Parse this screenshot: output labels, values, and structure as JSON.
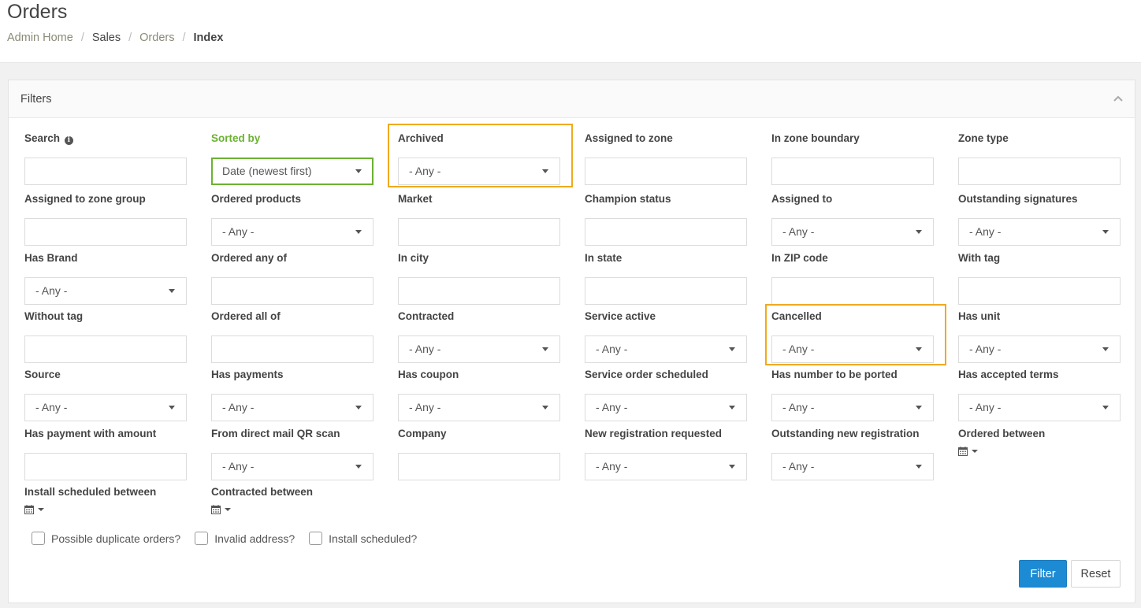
{
  "page": {
    "title": "Orders",
    "breadcrumb": [
      "Admin Home",
      "Sales",
      "Orders",
      "Index"
    ]
  },
  "filters": {
    "panel_title": "Filters",
    "fields": [
      {
        "name": "search",
        "label": "Search",
        "type": "text",
        "value": ""
      },
      {
        "name": "sorted-by",
        "label": "Sorted by",
        "type": "select",
        "value": "Date (newest first)"
      },
      {
        "name": "archived",
        "label": "Archived",
        "type": "select",
        "value": "- Any -"
      },
      {
        "name": "assigned-to-zone",
        "label": "Assigned to zone",
        "type": "text",
        "value": ""
      },
      {
        "name": "in-zone-boundary",
        "label": "In zone boundary",
        "type": "text",
        "value": ""
      },
      {
        "name": "zone-type",
        "label": "Zone type",
        "type": "text",
        "value": ""
      },
      {
        "name": "assigned-to-zone-group",
        "label": "Assigned to zone group",
        "type": "text",
        "value": ""
      },
      {
        "name": "ordered-products",
        "label": "Ordered products",
        "type": "select",
        "value": "- Any -"
      },
      {
        "name": "market",
        "label": "Market",
        "type": "text",
        "value": ""
      },
      {
        "name": "champion-status",
        "label": "Champion status",
        "type": "text",
        "value": ""
      },
      {
        "name": "assigned-to",
        "label": "Assigned to",
        "type": "select",
        "value": "- Any -"
      },
      {
        "name": "outstanding-signatures",
        "label": "Outstanding signatures",
        "type": "select",
        "value": "- Any -"
      },
      {
        "name": "has-brand",
        "label": "Has Brand",
        "type": "select",
        "value": "- Any -"
      },
      {
        "name": "ordered-any-of",
        "label": "Ordered any of",
        "type": "text",
        "value": ""
      },
      {
        "name": "in-city",
        "label": "In city",
        "type": "text",
        "value": ""
      },
      {
        "name": "in-state",
        "label": "In state",
        "type": "text",
        "value": ""
      },
      {
        "name": "in-zip-code",
        "label": "In ZIP code",
        "type": "text",
        "value": ""
      },
      {
        "name": "with-tag",
        "label": "With tag",
        "type": "text",
        "value": ""
      },
      {
        "name": "without-tag",
        "label": "Without tag",
        "type": "text",
        "value": ""
      },
      {
        "name": "ordered-all-of",
        "label": "Ordered all of",
        "type": "text",
        "value": ""
      },
      {
        "name": "contracted",
        "label": "Contracted",
        "type": "select",
        "value": "- Any -"
      },
      {
        "name": "service-active",
        "label": "Service active",
        "type": "select",
        "value": "- Any -"
      },
      {
        "name": "cancelled",
        "label": "Cancelled",
        "type": "select",
        "value": "- Any -"
      },
      {
        "name": "has-unit",
        "label": "Has unit",
        "type": "select",
        "value": "- Any -"
      },
      {
        "name": "source",
        "label": "Source",
        "type": "select",
        "value": "- Any -"
      },
      {
        "name": "has-payments",
        "label": "Has payments",
        "type": "select",
        "value": "- Any -"
      },
      {
        "name": "has-coupon",
        "label": "Has coupon",
        "type": "select",
        "value": "- Any -"
      },
      {
        "name": "service-order-scheduled",
        "label": "Service order scheduled",
        "type": "select",
        "value": "- Any -"
      },
      {
        "name": "has-number-to-be-ported",
        "label": "Has number to be ported",
        "type": "select",
        "value": "- Any -"
      },
      {
        "name": "has-accepted-terms",
        "label": "Has accepted terms",
        "type": "select",
        "value": "- Any -"
      },
      {
        "name": "has-payment-with-amount",
        "label": "Has payment with amount",
        "type": "text",
        "value": ""
      },
      {
        "name": "from-direct-mail-qr-scan",
        "label": "From direct mail QR scan",
        "type": "select",
        "value": "- Any -"
      },
      {
        "name": "company",
        "label": "Company",
        "type": "text",
        "value": ""
      },
      {
        "name": "new-registration-requested",
        "label": "New registration requested",
        "type": "select",
        "value": "- Any -"
      },
      {
        "name": "outstanding-new-registration",
        "label": "Outstanding new registration",
        "type": "select",
        "value": "- Any -"
      },
      {
        "name": "ordered-between",
        "label": "Ordered between",
        "type": "date",
        "value": ""
      },
      {
        "name": "install-scheduled-between",
        "label": "Install scheduled between",
        "type": "date",
        "value": ""
      },
      {
        "name": "contracted-between",
        "label": "Contracted between",
        "type": "date",
        "value": ""
      }
    ],
    "checkboxes": [
      {
        "name": "possible-duplicate-orders",
        "label": "Possible duplicate orders?",
        "checked": false
      },
      {
        "name": "invalid-address",
        "label": "Invalid address?",
        "checked": false
      },
      {
        "name": "install-scheduled",
        "label": "Install scheduled?",
        "checked": false
      }
    ],
    "filter_button": "Filter",
    "reset_button": "Reset"
  },
  "colors": {
    "primary": "#1d8bd4",
    "accent_green": "#6bb232",
    "highlight": "#f0a91f"
  }
}
